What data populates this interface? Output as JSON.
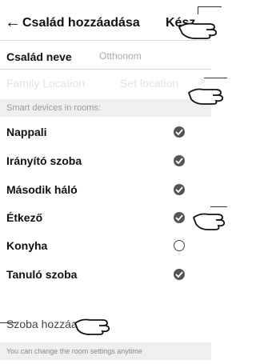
{
  "header": {
    "back_icon": "arrow-left-icon",
    "title": "Család hozzáadása",
    "done_label": "Kész"
  },
  "family_name": {
    "label": "Család neve",
    "value": "Otthonom"
  },
  "family_location": {
    "label": "Family Location",
    "value": "Set location",
    "chevron": ">"
  },
  "rooms_section": {
    "title": "Smart devices in rooms:"
  },
  "rooms": [
    {
      "label": "Nappali",
      "checked": true
    },
    {
      "label": "Irányító szoba",
      "checked": true
    },
    {
      "label": "Második háló",
      "checked": true
    },
    {
      "label": "Étkező",
      "checked": true
    },
    {
      "label": "Konyha",
      "checked": false
    },
    {
      "label": "Tanuló szoba",
      "checked": true
    }
  ],
  "add_room_label": "Szoba hozzáadása",
  "footer_note": "You can change the room settings anytime",
  "colors": {
    "checked": "#555555",
    "section_bg": "#efefef",
    "disabled_text": "#e3e3e3"
  }
}
